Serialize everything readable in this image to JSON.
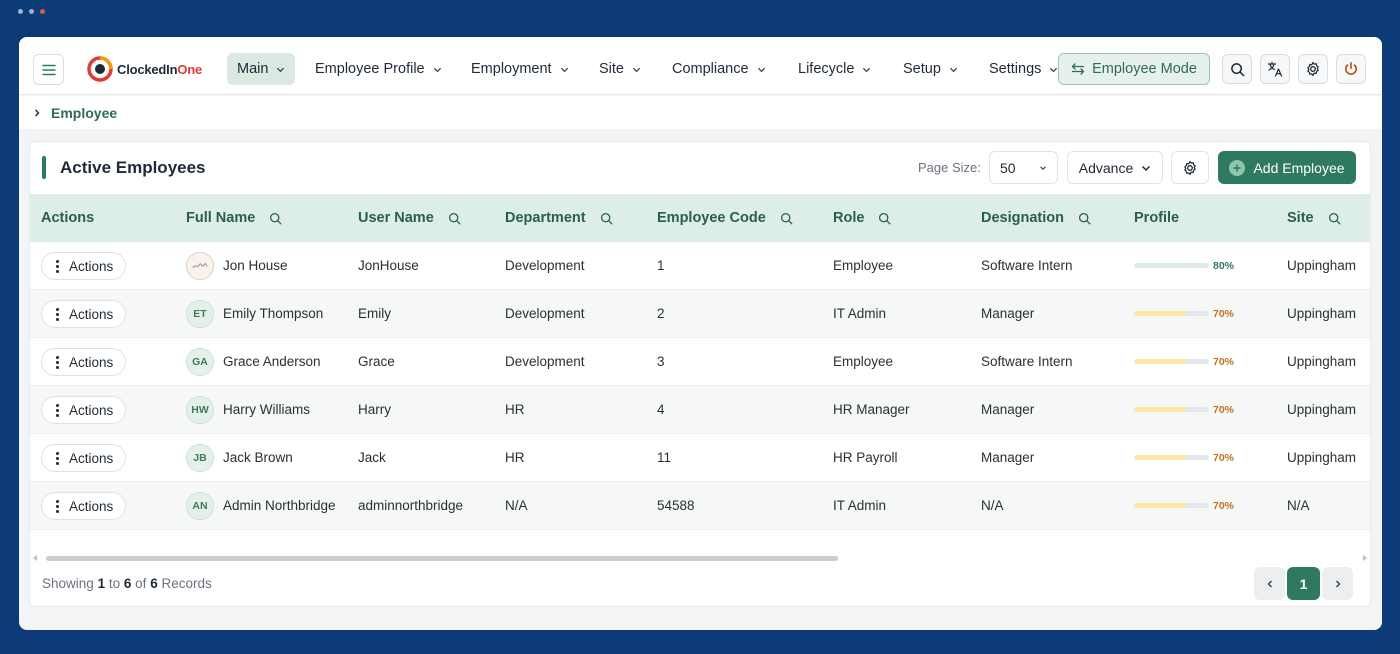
{
  "app": {
    "logo_text": "ClockedIn",
    "logo_accent": "One"
  },
  "nav": {
    "items": [
      {
        "label": "Main",
        "active": true
      },
      {
        "label": "Employee Profile"
      },
      {
        "label": "Employment"
      },
      {
        "label": "Site"
      },
      {
        "label": "Compliance"
      },
      {
        "label": "Lifecycle"
      },
      {
        "label": "Setup"
      },
      {
        "label": "Settings"
      }
    ],
    "mode_button": "Employee Mode",
    "icons": [
      "search-icon",
      "translate-icon",
      "gear-icon",
      "power-icon"
    ]
  },
  "breadcrumb": {
    "current": "Employee"
  },
  "card": {
    "title": "Active Employees",
    "page_size_label": "Page Size:",
    "page_size_value": "50",
    "advance_label": "Advance",
    "add_label": "Add Employee"
  },
  "table": {
    "headers": {
      "actions": "Actions",
      "full_name": "Full Name",
      "user_name": "User Name",
      "department": "Department",
      "employee_code": "Employee Code",
      "role": "Role",
      "designation": "Designation",
      "profile": "Profile",
      "site": "Site"
    },
    "action_label": "Actions",
    "rows": [
      {
        "initials": "",
        "photo": true,
        "full_name": "Jon House",
        "user_name": "JonHouse",
        "department": "Development",
        "code": "1",
        "role": "Employee",
        "designation": "Software Intern",
        "profile": 80,
        "profile_text": "80%",
        "site": "Uppingham"
      },
      {
        "initials": "ET",
        "full_name": "Emily Thompson",
        "user_name": "Emily",
        "department": "Development",
        "code": "2",
        "role": "IT Admin",
        "designation": "Manager",
        "profile": 70,
        "profile_text": "70%",
        "site": "Uppingham"
      },
      {
        "initials": "GA",
        "full_name": "Grace Anderson",
        "user_name": "Grace",
        "department": "Development",
        "code": "3",
        "role": "Employee",
        "designation": "Software Intern",
        "profile": 70,
        "profile_text": "70%",
        "site": "Uppingham"
      },
      {
        "initials": "HW",
        "full_name": "Harry Williams",
        "user_name": "Harry",
        "department": "HR",
        "code": "4",
        "role": "HR Manager",
        "designation": "Manager",
        "profile": 70,
        "profile_text": "70%",
        "site": "Uppingham"
      },
      {
        "initials": "JB",
        "full_name": "Jack Brown",
        "user_name": "Jack",
        "department": "HR",
        "code": "11",
        "role": "HR Payroll",
        "designation": "Manager",
        "profile": 70,
        "profile_text": "70%",
        "site": "Uppingham"
      },
      {
        "initials": "AN",
        "full_name": "Admin Northbridge",
        "user_name": "adminnorthbridge",
        "department": "N/A",
        "code": "54588",
        "role": "IT Admin",
        "designation": "N/A",
        "profile": 70,
        "profile_text": "70%",
        "site": "N/A"
      }
    ]
  },
  "footer": {
    "showing": "Showing",
    "from": "1",
    "to_word": "to",
    "to": "6",
    "of_word": "of",
    "total": "6",
    "records": "Records",
    "current_page": "1"
  },
  "colors": {
    "brand": "#2f7a5e",
    "header_bg": "#dceee6",
    "profile_high_fill": "#dbeae3",
    "profile_high_text": "#2f7a5e",
    "profile_mid_fill": "#fbe7a6",
    "profile_mid_text": "#c0741a"
  }
}
